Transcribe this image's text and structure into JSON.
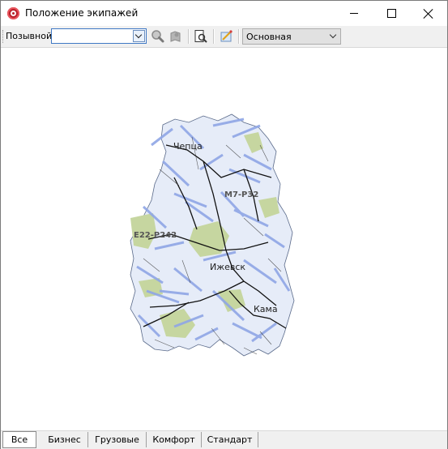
{
  "window": {
    "title": "Положение экипажей"
  },
  "toolbar": {
    "callsign_label": "Позывной:",
    "callsign_value": "",
    "icons": [
      "zoom-in-icon",
      "map-pin-icon",
      "print-preview-icon",
      "map-tool-icon"
    ],
    "layer_value": "Основная"
  },
  "map": {
    "places": {
      "chepts": "Чепца",
      "izhevsk": "Ижевск",
      "kama": "Кама"
    },
    "roads": {
      "r1": "М7-Р32",
      "r2": "Е22-Р242"
    }
  },
  "tabs": [
    {
      "label": "Все",
      "active": true
    },
    {
      "label": "Бизнес",
      "active": false
    },
    {
      "label": "Грузовые",
      "active": false
    },
    {
      "label": "Комфорт",
      "active": false
    },
    {
      "label": "Стандарт",
      "active": false
    }
  ]
}
